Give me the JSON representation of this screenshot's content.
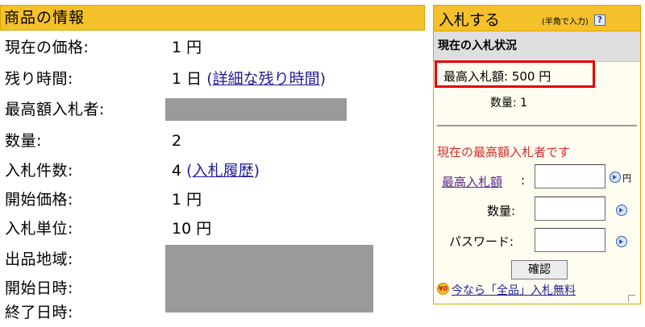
{
  "left": {
    "header": "商品の情報",
    "rows": [
      {
        "label": "現在の価格:",
        "value": "1 円"
      },
      {
        "label": "残り時間:",
        "value": "1 日",
        "link_open": "(",
        "link": "詳細な残り時間",
        "link_close": ")"
      },
      {
        "label": "最高額入札者:",
        "value": ""
      },
      {
        "label": "数量:",
        "value": "2"
      },
      {
        "label": "入札件数:",
        "value": "4",
        "link_open": "(",
        "link": "入札履歴",
        "link_close": ")"
      },
      {
        "label": "開始価格:",
        "value": "1 円"
      },
      {
        "label": "入札単位:",
        "value": "10 円"
      },
      {
        "label": "出品地域:",
        "value": ""
      },
      {
        "label": "開始日時:",
        "value": ""
      },
      {
        "label": "終了日時:",
        "value": ""
      }
    ]
  },
  "right": {
    "title": "入札する",
    "hint": "(半角で入力)",
    "help": "?",
    "status_title": "現在の入札状況",
    "max_bid": "最高入札額: 500 円",
    "quantity": "数量: 1",
    "leader_message": "現在の最高額入札者です",
    "form": {
      "max_bid_label": "最高入札額",
      "max_bid_colon": ":",
      "yen": "円",
      "quantity_label": "数量:",
      "password_label": "パスワード:",
      "max_bid_value": "",
      "quantity_value": "",
      "password_value": ""
    },
    "confirm": "確認",
    "promo_icon": "¥0",
    "promo": "今なら「全品」入札無料"
  },
  "colors": {
    "header_bg": "#f5c12a",
    "highlight_border": "#e30000",
    "leader_text": "#d22b2b",
    "link": "#1f1f99",
    "redacted": "#9a9a9a"
  },
  "icons": [
    "help-icon",
    "lookup-icon",
    "yen-free-icon"
  ]
}
